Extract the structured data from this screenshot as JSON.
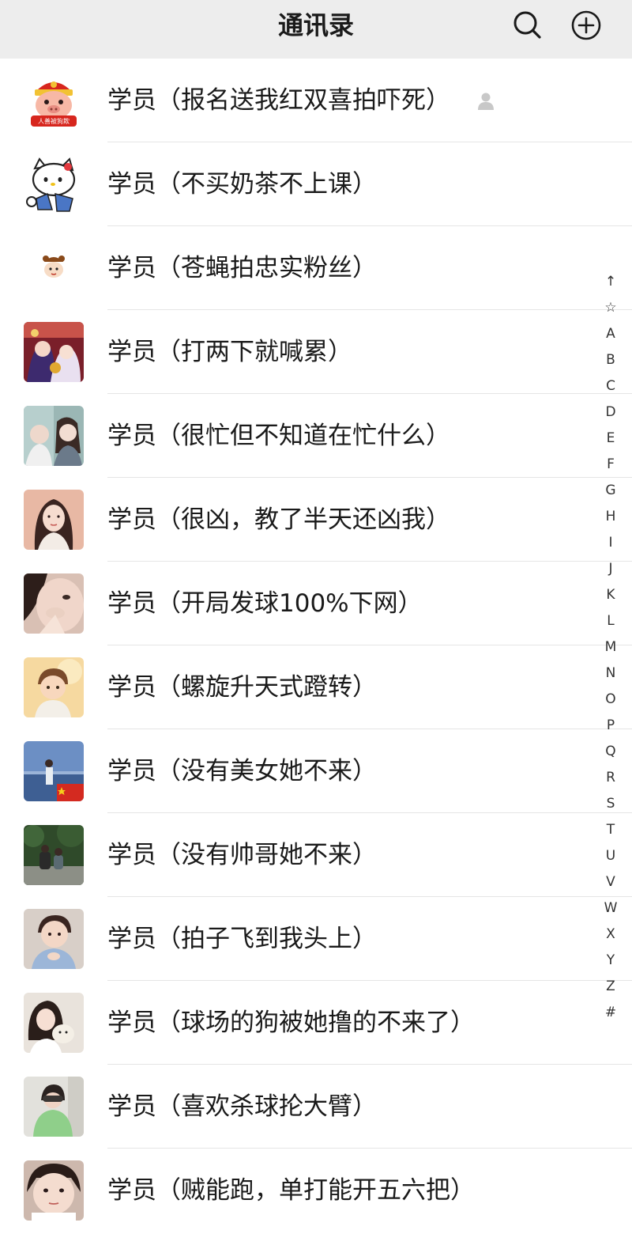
{
  "header": {
    "title": "通讯录"
  },
  "colors": {
    "header_bg": "#ededed",
    "divider": "#e5e5e5",
    "text": "#1a1a1a"
  },
  "contacts": [
    {
      "name": "学员（报名送我红双喜拍吓死）",
      "avatar": "cartoon-pig-avatar",
      "avatar_text": "人善被狗欺"
    },
    {
      "name": "学员（不买奶茶不上课）",
      "avatar": "hello-kitty-avatar"
    },
    {
      "name": "学员（苍蝇拍忠实粉丝）",
      "avatar": "small-cartoon-avatar"
    },
    {
      "name": "学员（打两下就喊累）",
      "avatar": "anime-girls-avatar"
    },
    {
      "name": "学员（很忙但不知道在忙什么）",
      "avatar": "two-girls-photo-avatar"
    },
    {
      "name": "学员（很凶，教了半天还凶我）",
      "avatar": "girl-portrait-avatar"
    },
    {
      "name": "学员（开局发球100%下网）",
      "avatar": "closeup-face-avatar"
    },
    {
      "name": "学员（螺旋升天式蹬转）",
      "avatar": "cartoon-boy-avatar"
    },
    {
      "name": "学员（没有美女她不来）",
      "avatar": "sea-flag-avatar"
    },
    {
      "name": "学员（没有帅哥她不来）",
      "avatar": "park-photo-avatar"
    },
    {
      "name": "学员（拍子飞到我头上）",
      "avatar": "baby-photo-avatar"
    },
    {
      "name": "学员（球场的狗被她撸的不来了）",
      "avatar": "girl-with-pet-avatar"
    },
    {
      "name": "学员（喜欢杀球抡大臂）",
      "avatar": "green-shirt-avatar"
    },
    {
      "name": "学员（贼能跑，单打能开五六把）",
      "avatar": "child-face-avatar"
    }
  ],
  "alpha_index": [
    "↑",
    "☆",
    "A",
    "B",
    "C",
    "D",
    "E",
    "F",
    "G",
    "H",
    "I",
    "J",
    "K",
    "L",
    "M",
    "N",
    "O",
    "P",
    "Q",
    "R",
    "S",
    "T",
    "U",
    "V",
    "W",
    "X",
    "Y",
    "Z",
    "#"
  ]
}
